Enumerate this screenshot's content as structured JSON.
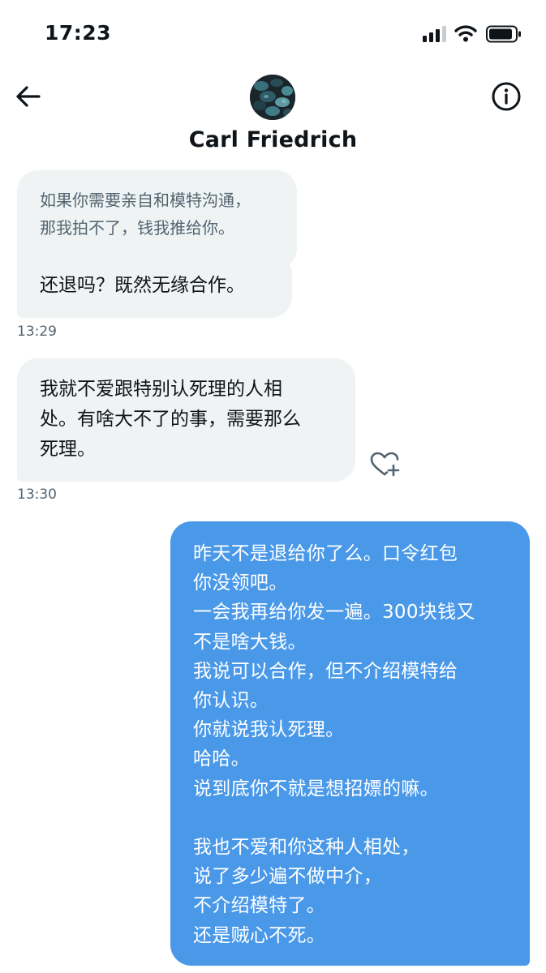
{
  "status_bar": {
    "time": "17:23"
  },
  "header": {
    "contact_name": "Carl Friedrich",
    "back_icon": "arrow-left-icon",
    "info_icon": "info-circle-icon"
  },
  "messages": [
    {
      "direction": "incoming",
      "text": "如果你需要亲自和模特沟通，\n那我拍不了，钱我推给你。"
    },
    {
      "direction": "incoming",
      "text": "还退吗？既然无缘合作。"
    },
    {
      "direction": "incoming",
      "text": "我就不爱跟特别认死理的人相\n处。有啥大不了的事，需要那么\n死理。"
    },
    {
      "direction": "outgoing",
      "text": "昨天不是退给你了么。口令红包\n你没领吧。\n一会我再给你发一遍。300块钱又\n不是啥大钱。\n我说可以合作，但不介绍模特给\n你认识。\n你就说我认死理。\n哈哈。\n说到底你不就是想招嫖的嘛。\n\n我也不爱和你这种人相处，\n说了多少遍不做中介，\n不介绍模特了。\n还是贼心不死。"
    }
  ],
  "timestamps": [
    "13:29",
    "13:30"
  ],
  "colors": {
    "incoming_bubble": "#eff3f4",
    "outgoing_bubble": "#4a99e9",
    "text_primary": "#0f1419",
    "text_secondary": "#536471"
  }
}
